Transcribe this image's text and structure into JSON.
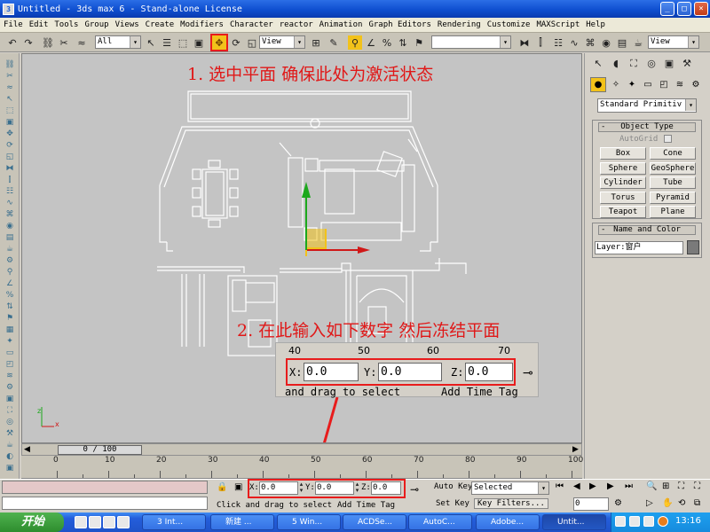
{
  "ui": {
    "title": "Untitled - 3ds max 6 - Stand-alone License",
    "menu": [
      "File",
      "Edit",
      "Tools",
      "Group",
      "Views",
      "Create",
      "Modifiers",
      "Character",
      "reactor",
      "Animation",
      "Graph Editors",
      "Rendering",
      "Customize",
      "MAXScript",
      "Help"
    ],
    "toolbar": {
      "selection_filter": "All",
      "ref_coord": "View",
      "named_sets": "",
      "render_view": "View"
    },
    "colors": {
      "annotation_red": "#e81c1c",
      "title_blue": "#0f4fd0",
      "viewport_bg": "#c4c4c4",
      "gizmo_green": "#1ca81c",
      "gizmo_red": "#d01818",
      "highlight_yellow": "#f2c21a"
    },
    "window_controls": [
      "minimize-icon",
      "maximize-icon",
      "close-icon"
    ]
  },
  "left_toolbar": {
    "icons": [
      "link-icon",
      "unlink-icon",
      "bind-space-warp-icon",
      "select-icon",
      "select-region-icon",
      "select-window-icon",
      "select-move-icon",
      "rotate-icon",
      "scale-icon",
      "mirror-icon",
      "align-icon",
      "layer-icon",
      "curve-editor-icon",
      "schematic-icon",
      "material-editor-icon",
      "render-icon",
      "quick-render-icon",
      "render-scene-icon",
      "snap-icon",
      "angle-snap-icon",
      "percent-snap-icon",
      "spinner-snap-icon",
      "named-selection-icon",
      "grid-icon",
      "light-icon",
      "camera-icon",
      "helper-icon",
      "spacewarp-icon",
      "system-icon",
      "display-icon",
      "hierarchy-icon",
      "motion-icon",
      "utility-icon",
      "teapot-icon",
      "shade-icon",
      "max-icon"
    ]
  },
  "viewport": {
    "annotation1": "1. 选中平面  确保此处为激活状态",
    "annotation2": "2.  在此输入如下数字 然后冻结平面",
    "zoom": {
      "ruler": [
        "40",
        "50",
        "60",
        "70"
      ],
      "x_label": "X:",
      "y_label": "Y:",
      "z_label": "Z:",
      "x": "0.0",
      "y": "0.0",
      "z": "0.0",
      "prompt": "and drag to select",
      "add_time_tag": "Add Time Tag"
    },
    "axis": {
      "x": "x",
      "z": "z"
    }
  },
  "right_panel": {
    "dropdown": "Standard Primitiv",
    "object_type_header": "Object Type",
    "autogrid": "AutoGrid",
    "buttons": [
      "Box",
      "Cone",
      "Sphere",
      "GeoSphere",
      "Cylinder",
      "Tube",
      "Torus",
      "Pyramid",
      "Teapot",
      "Plane"
    ],
    "name_color_header": "Name and Color",
    "layer_name": "Layer:窗户",
    "rollout_sign": "-"
  },
  "timeline": {
    "frame_counter": "0 / 100",
    "ticks": [
      "0",
      "10",
      "20",
      "30",
      "40",
      "50",
      "60",
      "70",
      "80",
      "90",
      "100"
    ]
  },
  "status_bar": {
    "x_label": "X:",
    "y_label": "Y:",
    "z_label": "Z:",
    "x": "0.0",
    "y": "0.0",
    "z": "0.0",
    "prompt": "Click and drag to select",
    "add_time_tag": "Add Time Tag",
    "auto_key": "Auto Key",
    "set_key": "Set Key",
    "key_mode": "Selected",
    "key_filters": "Key Filters...",
    "frame": "0"
  },
  "taskbar": {
    "start": "开始",
    "items": [
      "3 Int...",
      "新建 ...",
      "5 Win...",
      "ACDSe...",
      "AutoC...",
      "Adobe...",
      "Untit..."
    ],
    "time": "13:16"
  }
}
